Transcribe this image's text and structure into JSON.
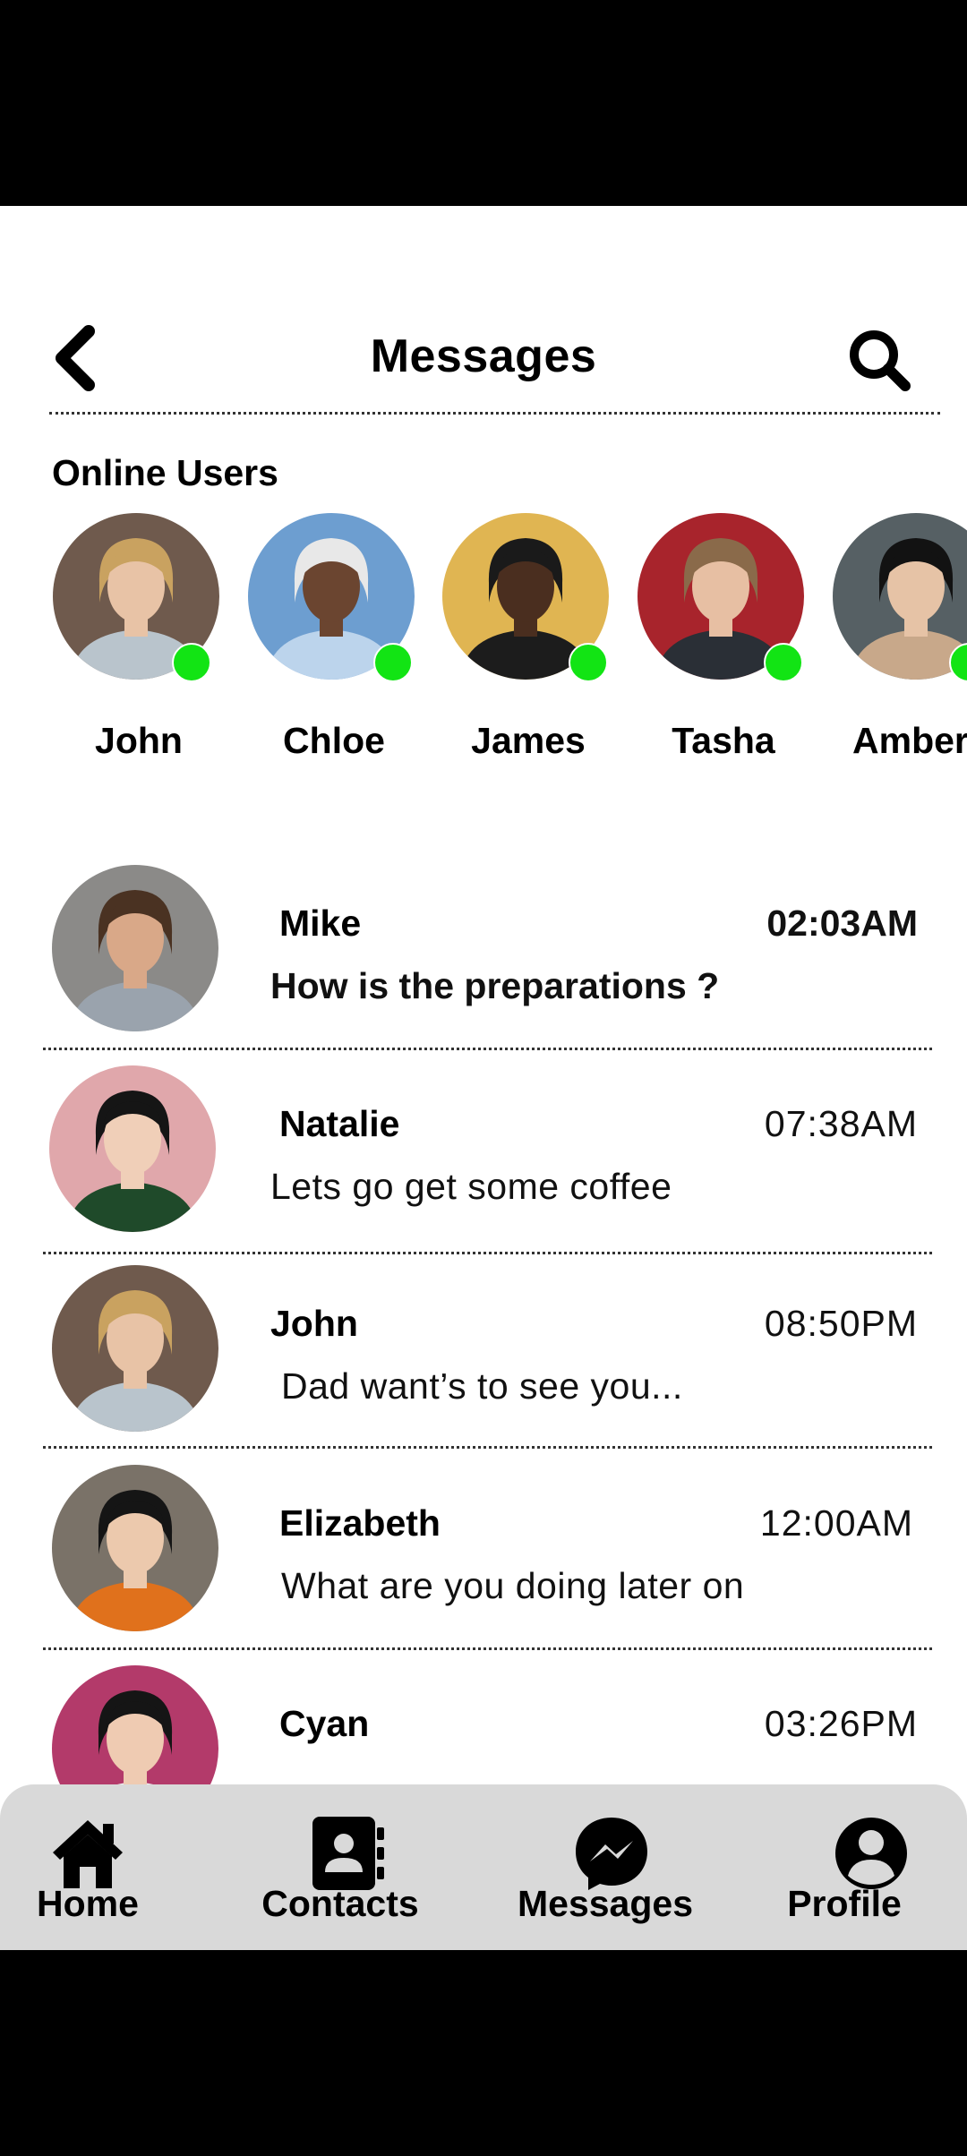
{
  "header": {
    "title": "Messages"
  },
  "online_section": {
    "title": "Online Users"
  },
  "online_users": [
    {
      "name": "John",
      "avatar_bg": "#6f5a4d",
      "skin": "#e8c3a6",
      "hair": "#c9a260",
      "shirt": "#b9c4cc"
    },
    {
      "name": "Chloe",
      "avatar_bg": "#6d9ed0",
      "skin": "#6b4530",
      "hair": "#e8e8e8",
      "shirt": "#bcd4ec"
    },
    {
      "name": "James",
      "avatar_bg": "#e0b552",
      "skin": "#4a2e1f",
      "hair": "#1a1a1a",
      "shirt": "#1c1c1c"
    },
    {
      "name": "Tasha",
      "avatar_bg": "#a8242c",
      "skin": "#e7bfa3",
      "hair": "#8a6a4a",
      "shirt": "#2a2f36"
    },
    {
      "name": "Amber",
      "avatar_bg": "#566064",
      "skin": "#e6c3a6",
      "hair": "#121212",
      "shirt": "#c8a88a"
    }
  ],
  "conversations": [
    {
      "name": "Mike",
      "time": "02:03AM",
      "message": "How is the preparations ?",
      "unread": true,
      "avatar_bg": "#8b8a88",
      "skin": "#d9a888",
      "hair": "#4a3222",
      "shirt": "#9aa3ad"
    },
    {
      "name": "Natalie",
      "time": "07:38AM",
      "message": "Lets go get some coffee",
      "unread": false,
      "avatar_bg": "#e0a7ab",
      "skin": "#f0cfb8",
      "hair": "#151515",
      "shirt": "#1f4a2a"
    },
    {
      "name": "John",
      "time": "08:50PM",
      "message": "Dad want’s to see you...",
      "unread": false,
      "avatar_bg": "#6f5a4d",
      "skin": "#e8c3a6",
      "hair": "#c9a260",
      "shirt": "#b9c4cc"
    },
    {
      "name": "Elizabeth",
      "time": "12:00AM",
      "message": "What are you doing later on",
      "unread": false,
      "avatar_bg": "#7a7268",
      "skin": "#ecc9ad",
      "hair": "#151515",
      "shirt": "#e0711c"
    },
    {
      "name": "Cyan",
      "time": "03:26PM",
      "message": "",
      "unread": false,
      "avatar_bg": "#b33a6a",
      "skin": "#efcbb2",
      "hair": "#151515",
      "shirt": "#f3f3f3"
    }
  ],
  "nav": [
    {
      "label": "Home",
      "icon": "home-icon"
    },
    {
      "label": "Contacts",
      "icon": "contacts-icon"
    },
    {
      "label": "Messages",
      "icon": "messenger-icon"
    },
    {
      "label": "Profile",
      "icon": "profile-icon"
    }
  ],
  "colors": {
    "online": "#12e414",
    "nav_bg": "#d9d9d9"
  }
}
